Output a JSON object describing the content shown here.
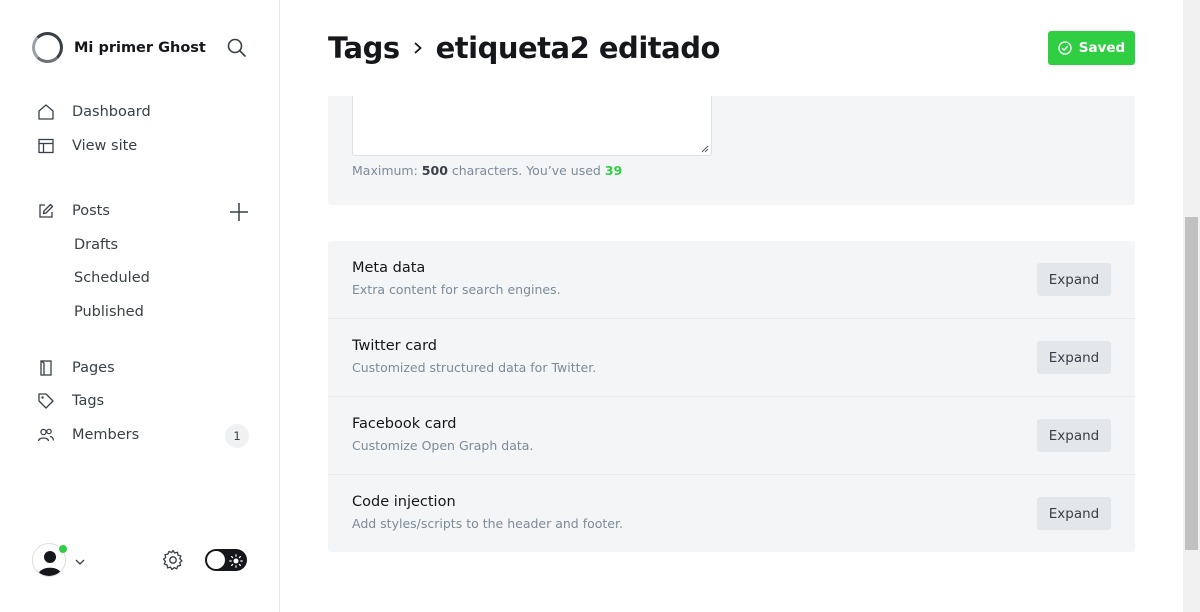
{
  "sidebar": {
    "site_name": "Mi primer Ghost",
    "nav": {
      "dashboard": "Dashboard",
      "view_site": "View site",
      "posts": "Posts",
      "drafts": "Drafts",
      "scheduled": "Scheduled",
      "published": "Published",
      "pages": "Pages",
      "tags": "Tags",
      "members": "Members",
      "members_count": "1"
    }
  },
  "header": {
    "breadcrumb_parent": "Tags",
    "breadcrumb_current": "etiqueta2 editado",
    "saved_label": "Saved"
  },
  "description": {
    "counter_prefix": "Maximum:",
    "max": "500",
    "counter_mid": "characters. You’ve used",
    "used": "39"
  },
  "settings": {
    "expand_label": "Expand",
    "rows": [
      {
        "title": "Meta data",
        "desc": "Extra content for search engines."
      },
      {
        "title": "Twitter card",
        "desc": "Customized structured data for Twitter."
      },
      {
        "title": "Facebook card",
        "desc": "Customize Open Graph data."
      },
      {
        "title": "Code injection",
        "desc": "Add styles/scripts to the header and footer."
      }
    ]
  },
  "colors": {
    "accent_green": "#30cf43",
    "panel_bg": "#f4f5f6",
    "text_dark": "#15171a",
    "text_muted": "#7c8b9a"
  },
  "icons": [
    "search-icon",
    "home-icon",
    "view-site-icon",
    "edit-icon",
    "plus-icon",
    "page-icon",
    "tag-icon",
    "members-icon",
    "user-avatar-icon",
    "chevron-down-icon",
    "gear-icon",
    "sun-icon",
    "chevron-right-icon",
    "check-circle-icon"
  ]
}
